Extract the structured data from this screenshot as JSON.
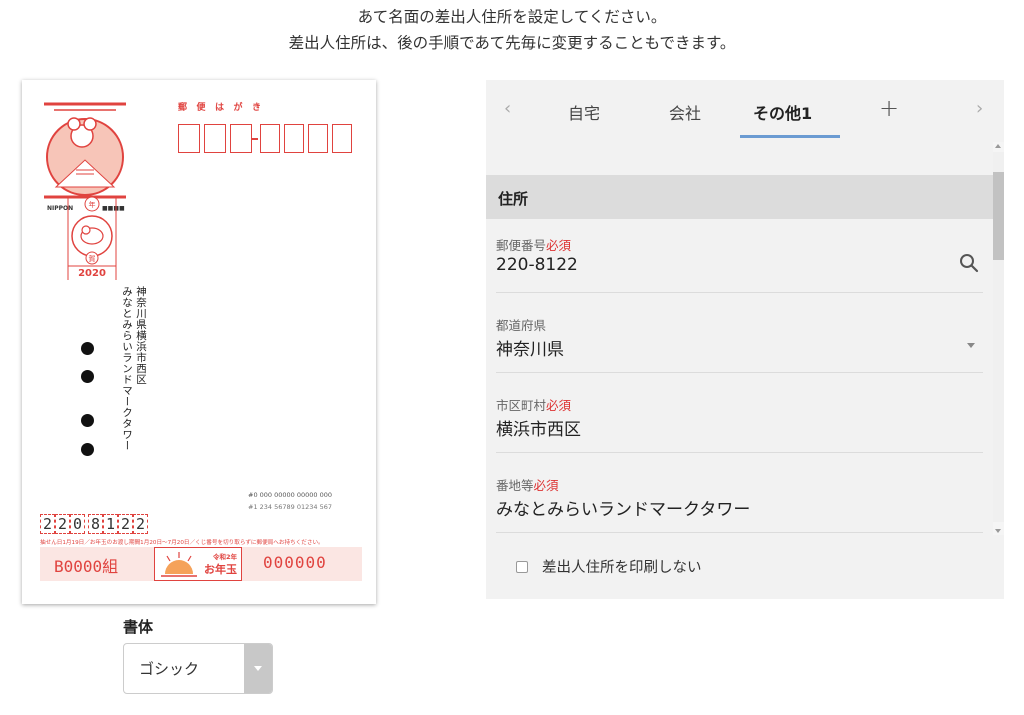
{
  "intro": {
    "line1": "あて名面の差出人住所を設定してください。",
    "line2": "差出人住所は、後の手順であて先毎に変更することもできます。"
  },
  "postcard": {
    "yubin_title": "郵便はがき",
    "stamp_year": "2020",
    "stamp_label": "NIPPON",
    "postmark_year": "2020",
    "postmark_top": "年",
    "postmark_bottom": "賀",
    "address_line1": "神奈川県横浜市西区",
    "address_line2": "みなとみらいランドマークタワー",
    "serial1": "#0 000 00000 00000 000",
    "serial2": "#1 234 56789 01234 567",
    "sender_zip": [
      "2",
      "2",
      "0",
      "8",
      "1",
      "2",
      "2"
    ],
    "lot_note": "抽せん日1月19日／お年玉のお渡し期間1月20日～7月20日／くじ番号を切り取らずに郵便局へお持ちください。",
    "lot_group": "B0000組",
    "lot_mid_line1": "令和2年",
    "lot_mid_line2": "お年玉",
    "lot_number": "000000"
  },
  "font": {
    "label": "書体",
    "value": "ゴシック"
  },
  "panel": {
    "tabs": [
      {
        "label": "自宅",
        "active": false
      },
      {
        "label": "会社",
        "active": false
      },
      {
        "label": "その他1",
        "active": true
      }
    ],
    "tab_add": "+",
    "tab_prev": "‹",
    "tab_next": "›",
    "section_title": "住所",
    "required_text": "必須",
    "fields": {
      "postal": {
        "label": "郵便番号",
        "value": "220-8122"
      },
      "prefecture": {
        "label": "都道府県",
        "value": "神奈川県"
      },
      "city": {
        "label": "市区町村",
        "value": "横浜市西区"
      },
      "street": {
        "label": "番地等",
        "value": "みなとみらいランドマークタワー"
      }
    },
    "no_print_label": "差出人住所を印刷しない"
  },
  "colors": {
    "postcard_red": "#e0433f",
    "tab_underline": "#6b9bd2",
    "required_red": "#dd3333"
  }
}
